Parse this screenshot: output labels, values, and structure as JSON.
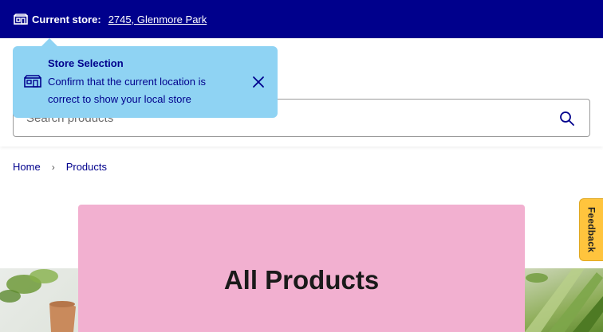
{
  "topbar": {
    "label": "Current store:",
    "store_link": "2745, Glenmore Park"
  },
  "popover": {
    "title": "Store Selection",
    "message": "Confirm that the current location is correct to show your local store"
  },
  "search": {
    "placeholder": "Search products"
  },
  "breadcrumb": {
    "items": [
      "Home",
      "Products"
    ],
    "separator": "›"
  },
  "feedback": {
    "label": "Feedback"
  },
  "hero": {
    "title": "All Products"
  },
  "colors": {
    "brand_navy": "#00008c",
    "popover_bg": "#8fd3f3",
    "hero_card": "#f2b0d0",
    "feedback_tab": "#ffc43d"
  }
}
